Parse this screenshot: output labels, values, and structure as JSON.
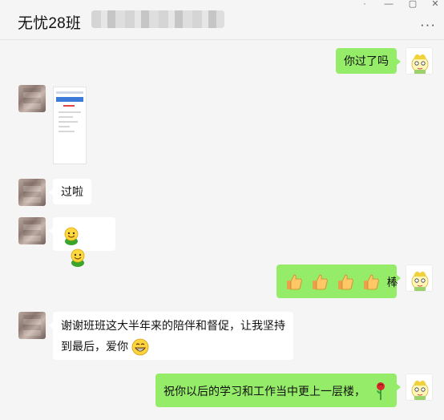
{
  "window": {
    "title": "无忧28班",
    "controls": [
      "·",
      "—",
      "▢",
      "✕"
    ],
    "more_label": "···"
  },
  "messages": [
    {
      "side": "right",
      "type": "text",
      "text": "你过了吗"
    },
    {
      "side": "left",
      "type": "image"
    },
    {
      "side": "left",
      "type": "text",
      "text": "过啦"
    },
    {
      "side": "left",
      "type": "emoji",
      "emoji": [
        "green-smiley-icon",
        "green-smiley-icon"
      ]
    },
    {
      "side": "right",
      "type": "emoji-text",
      "emoji": [
        "thumbs-up-icon",
        "thumbs-up-icon",
        "thumbs-up-icon",
        "thumbs-up-icon"
      ],
      "text": "棒"
    },
    {
      "side": "left",
      "type": "text",
      "line1": "谢谢班班这大半年来的陪伴和督促，让我坚持",
      "line2": "到最后，爱你",
      "emoji": "grin-icon"
    },
    {
      "side": "right",
      "type": "text",
      "text": "祝你以后的学习和工作当中更上一层楼，",
      "emoji": "rose-icon"
    }
  ],
  "colors": {
    "self_bubble": "#95ec69",
    "other_bubble": "#ffffff",
    "background": "#f5f5f5"
  }
}
